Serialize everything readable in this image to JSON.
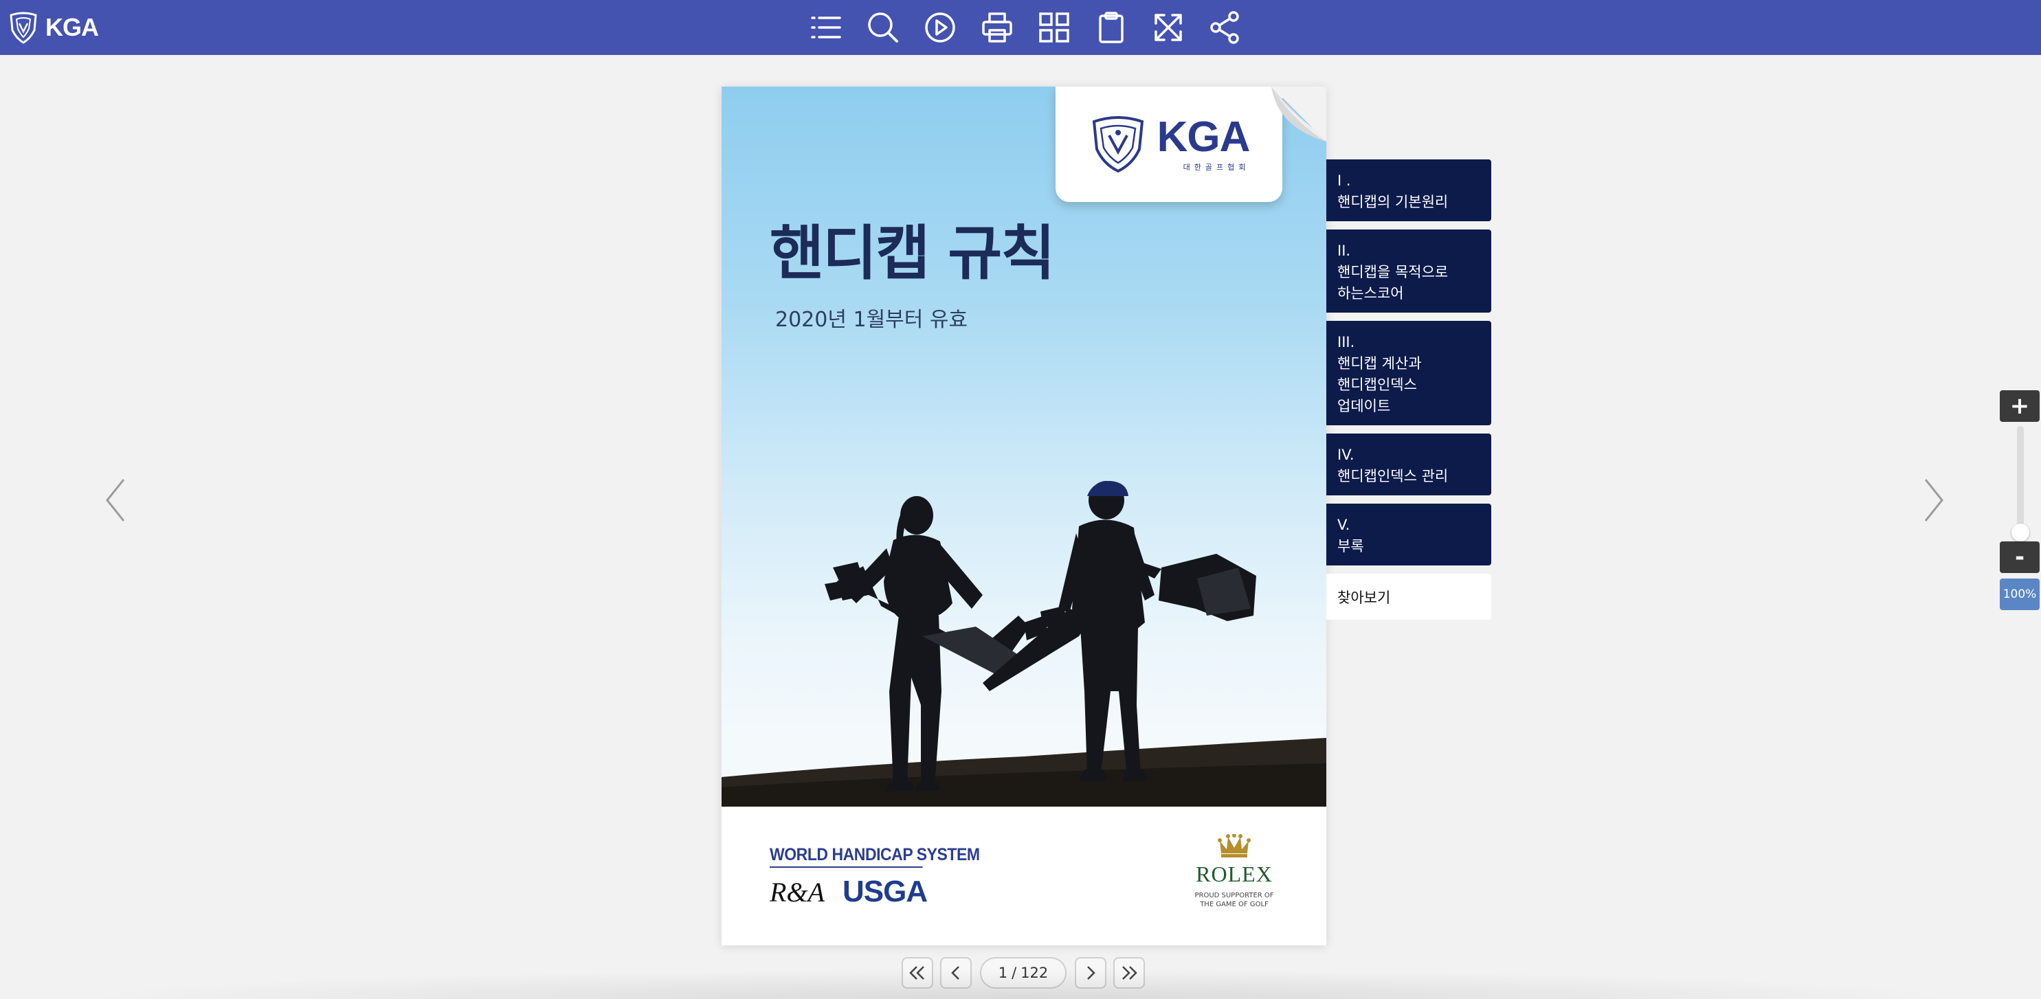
{
  "header": {
    "brand": "KGA",
    "toolbar": [
      {
        "name": "toc-list",
        "icon": "list-icon"
      },
      {
        "name": "search",
        "icon": "search-icon"
      },
      {
        "name": "autoplay",
        "icon": "play-icon"
      },
      {
        "name": "print",
        "icon": "printer-icon"
      },
      {
        "name": "thumbnails",
        "icon": "grid-icon"
      },
      {
        "name": "clipboard",
        "icon": "clipboard-icon"
      },
      {
        "name": "fullscreen",
        "icon": "expand-icon"
      },
      {
        "name": "share",
        "icon": "share-icon"
      }
    ],
    "background": "#4452b0"
  },
  "cover": {
    "title": "핸디캡 규칙",
    "subtitle": "2020년 1월부터 유효",
    "logo_text": "KGA",
    "logo_sub": "대한골프협회",
    "whs_title": "WORLD HANDICAP SYSTEM",
    "ra": "R&A",
    "usga_us": "US",
    "usga_ga": "GA",
    "rolex_name": "ROLEX",
    "rolex_tag_1": "PROUD SUPPORTER OF",
    "rolex_tag_2": "THE GAME OF GOLF"
  },
  "toc": [
    {
      "num": "I .",
      "text": "핸디캡의 기본원리"
    },
    {
      "num": "II.",
      "text": "핸디캡을 목적으로\n하는스코어"
    },
    {
      "num": "III.",
      "text": "핸디캡 계산과\n핸디캡인덱스\n업데이트"
    },
    {
      "num": "IV.",
      "text": "핸디캡인덱스 관리"
    },
    {
      "num": "V.",
      "text": "부록"
    }
  ],
  "toc_search": "찾아보기",
  "zoom": {
    "plus": "+",
    "minus": "-",
    "level": "100%"
  },
  "pager": {
    "current": "1",
    "separator": "/",
    "total": "122"
  },
  "colors": {
    "toc_bg": "#0c1b4a",
    "title": "#1c2b57",
    "zoom_level_bg": "#5b86c5"
  }
}
